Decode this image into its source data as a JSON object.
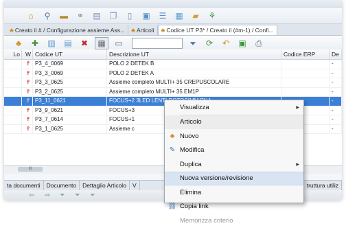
{
  "tabs": [
    {
      "label": "Creato il # / Configurazione assieme Ass..."
    },
    {
      "label": "Articoli"
    },
    {
      "label": "Codice UT P3* / Creato il (#m-1) / Confi..."
    }
  ],
  "grid": {
    "headers": {
      "lo": "Lo",
      "w": "W",
      "code": "Codice UT",
      "desc": "Descrizione UT",
      "erp": "Codice ERP",
      "de": "De"
    },
    "rows": [
      {
        "code": "P3_4_0069",
        "desc": "POLO 2 DETEK B",
        "erp": "",
        "de": "-"
      },
      {
        "code": "P3_3_0069",
        "desc": "POLO 2 DETEK A",
        "erp": "",
        "de": "-"
      },
      {
        "code": "P3_3_0625",
        "desc": "Assieme completo MULTI+ 35 CREPUSCOLARE",
        "erp": "",
        "de": "-"
      },
      {
        "code": "P3_2_0625",
        "desc": "Assieme completo MULTI+ 35  EM1P",
        "erp": "",
        "de": "-"
      },
      {
        "code": "P3_11_0621",
        "desc": "FOCUS+2 3LED LENTI ROTOSIMM PNA",
        "erp": "",
        "de": "-"
      },
      {
        "code": "P3_9_0621",
        "desc": "FOCUS+3",
        "erp": "",
        "de": "-"
      },
      {
        "code": "P3_7_0614",
        "desc": "FOCUS+1",
        "erp": "",
        "de": "-"
      },
      {
        "code": "P3_1_0625",
        "desc": "Assieme c",
        "erp": "",
        "de": "-"
      }
    ]
  },
  "scroll_thumb": "III",
  "bottom_tabs": [
    "ta documenti",
    "Documento",
    "Dettaglio Articolo",
    "V",
    "truttura utiliz"
  ],
  "context_menu": {
    "items": [
      {
        "label": "Visualizza",
        "icon": "",
        "submenu": true
      },
      {
        "label": "Articolo",
        "icon": "",
        "submenu": false
      },
      {
        "label": "Nuovo",
        "icon": "new-icon",
        "submenu": false
      },
      {
        "label": "Modifica",
        "icon": "edit-icon",
        "submenu": false
      },
      {
        "label": "Duplica",
        "icon": "",
        "submenu": true
      },
      {
        "label": "Nuova versione/revisione",
        "icon": "",
        "submenu": false
      },
      {
        "label": "Elimina",
        "icon": "",
        "submenu": false
      },
      {
        "label": "Copia link",
        "icon": "link-icon",
        "submenu": false
      },
      {
        "label": "Memorizza criterio",
        "icon": "",
        "submenu": false
      }
    ]
  },
  "colors": {
    "selection": "#3b7fd6",
    "menu_hover": "#d9e4f3",
    "tab_icon": "#d08a1c"
  }
}
